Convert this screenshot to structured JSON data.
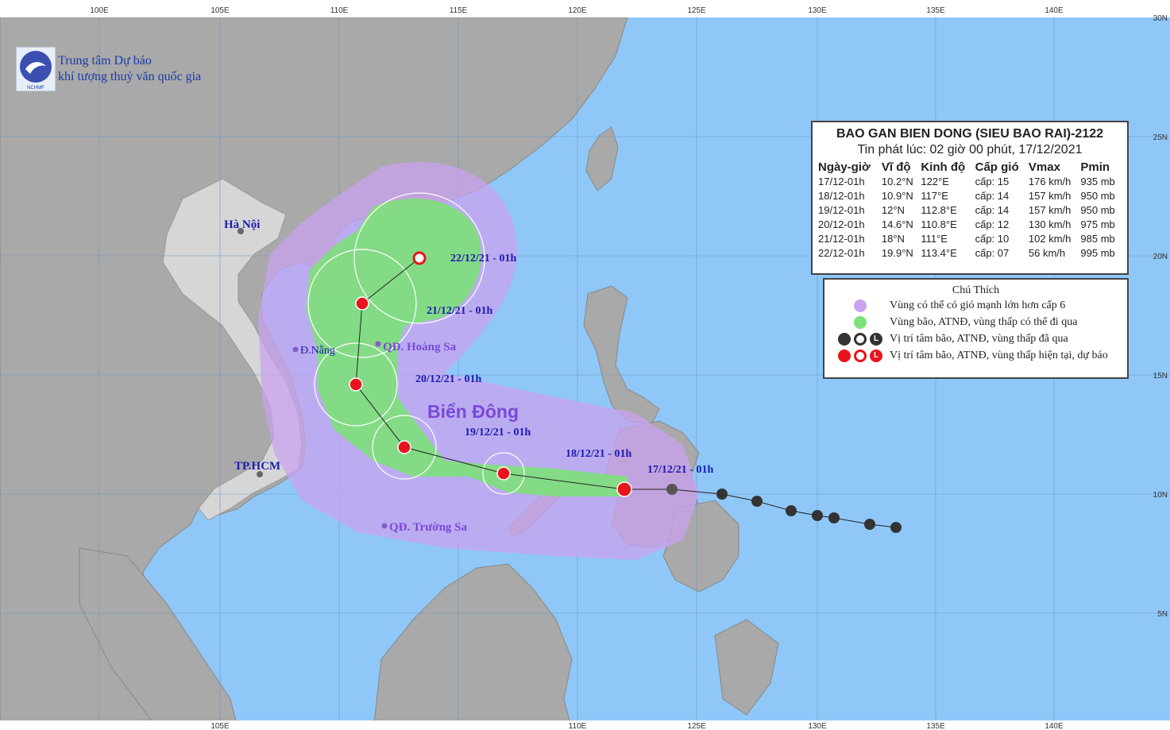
{
  "agency": {
    "line1": "Trung tâm Dự báo",
    "line2": "khí tượng thuỷ văn quốc gia",
    "logo_text": "NCHMF"
  },
  "graticule": {
    "lon_top": [
      "100E",
      "105E",
      "110E",
      "115E",
      "120E",
      "125E",
      "130E",
      "135E",
      "140E"
    ],
    "lon_bottom": [
      "105E",
      "110E",
      "125E",
      "130E",
      "135E",
      "140E"
    ],
    "lat_right": [
      "30N",
      "25N",
      "20N",
      "15N",
      "10N",
      "5N"
    ]
  },
  "places": {
    "hanoi": "Hà Nội",
    "danang": "Đ.Nẵng",
    "hcm": "TP.HCM",
    "hoangsa": "QĐ. Hoàng Sa",
    "truongsa": "QĐ. Trường Sa",
    "sea": "Biển Đông"
  },
  "track_labels": {
    "d17": "17/12/21 - 01h",
    "d18": "18/12/21 - 01h",
    "d19": "19/12/21 - 01h",
    "d20": "20/12/21 - 01h",
    "d21": "21/12/21 - 01h",
    "d22": "22/12/21 - 01h"
  },
  "info": {
    "title": "BAO GAN BIEN DONG (SIEU BAO RAI)-2122",
    "issued": "Tin phát lúc: 02 giờ 00 phút, 17/12/2021",
    "headers": [
      "Ngày-giờ",
      "Vĩ độ",
      "Kinh độ",
      "Cấp gió",
      "Vmax",
      "Pmin"
    ],
    "rows": [
      [
        "17/12-01h",
        "10.2°N",
        "122°E",
        "cấp: 15",
        "176 km/h",
        "935 mb"
      ],
      [
        "18/12-01h",
        "10.9°N",
        "117°E",
        "cấp: 14",
        "157 km/h",
        "950 mb"
      ],
      [
        "19/12-01h",
        "12°N",
        "112.8°E",
        "cấp: 14",
        "157 km/h",
        "950 mb"
      ],
      [
        "20/12-01h",
        "14.6°N",
        "110.8°E",
        "cấp: 12",
        "130 km/h",
        "975 mb"
      ],
      [
        "21/12-01h",
        "18°N",
        "111°E",
        "cấp: 10",
        "102 km/h",
        "985 mb"
      ],
      [
        "22/12-01h",
        "19.9°N",
        "113.4°E",
        "cấp: 07",
        "56 km/h",
        "995 mb"
      ]
    ]
  },
  "legend": {
    "title": "Chú Thích",
    "items": [
      "Vùng có thể có gió mạnh lớn hơn cấp 6",
      "Vùng bão, ATNĐ, vùng thấp có thể đi qua",
      "Vị trí tâm bão, ATNĐ, vùng thấp đã qua",
      "Vị trí tâm bão, ATNĐ, vùng thấp hiện tại, dự báo"
    ],
    "symbol_L": "L"
  },
  "colors": {
    "sea": "#8fc8f8",
    "land": "#a9a9a9",
    "wind_zone": "#c9a3f0",
    "storm_zone": "#7ee07a",
    "past_track": "#333333",
    "forecast": "#e8141c",
    "label_blue": "#1b1bb0",
    "sea_label": "#7a48d8"
  }
}
